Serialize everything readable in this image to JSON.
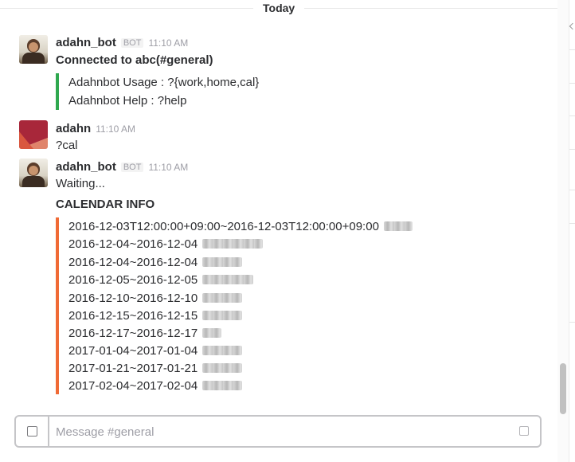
{
  "day_divider": "Today",
  "messages": [
    {
      "sender": "adahn_bot",
      "badge": "BOT",
      "time": "11:10 AM",
      "text": "Connected to abc(#general)",
      "attachment": {
        "color": "#2fa84f",
        "lines": [
          "Adahnbot Usage : ?{work,home,cal}",
          "Adahnbot Help : ?help"
        ]
      }
    },
    {
      "sender": "adahn",
      "time": "11:10 AM",
      "text": "?cal"
    },
    {
      "sender": "adahn_bot",
      "badge": "BOT",
      "time": "11:10 AM",
      "text": "Waiting...",
      "heading": "CALENDAR INFO",
      "attachment": {
        "color": "#f06a35",
        "lines": [
          "2016-12-03T12:00:00+09:00~2016-12-03T12:00:00+09:00",
          "2016-12-04~2016-12-04",
          "2016-12-04~2016-12-04",
          "2016-12-05~2016-12-05",
          "2016-12-10~2016-12-10",
          "2016-12-15~2016-12-15",
          "2016-12-17~2016-12-17",
          "2017-01-04~2017-01-04",
          "2017-01-21~2017-01-21",
          "2017-02-04~2017-02-04"
        ]
      }
    }
  ],
  "composer": {
    "placeholder": "Message #general"
  },
  "colors": {
    "accent_green": "#2fa84f",
    "accent_orange": "#f06a35",
    "user_avatar_dark": "#a8273a",
    "user_avatar_light": "#e0846b"
  },
  "icons": {
    "attach": "plus-square-icon",
    "emoji": "emoji-icon",
    "scroll": "chevron-down-icon"
  }
}
